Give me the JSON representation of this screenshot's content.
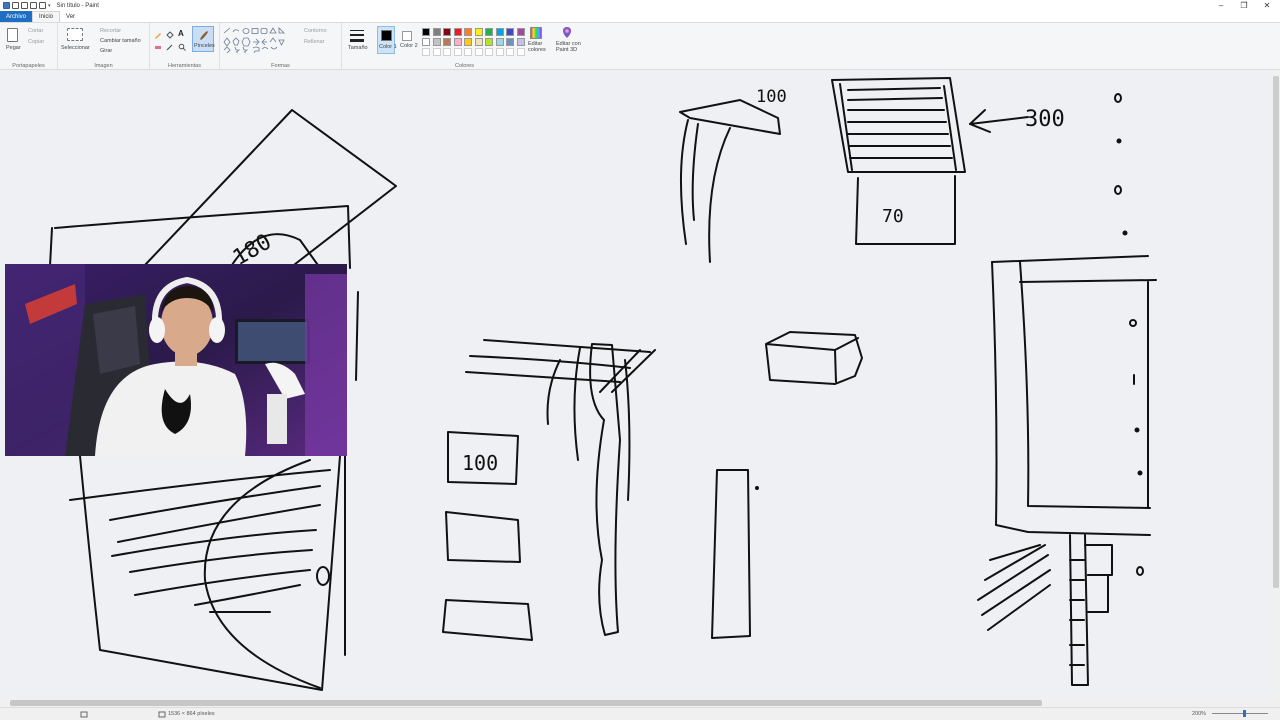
{
  "window": {
    "title": "Sin título - Paint",
    "minimize_glyph": "–",
    "restore_glyph": "❐",
    "close_glyph": "✕"
  },
  "tabs": [
    {
      "label": "Archivo"
    },
    {
      "label": "Inicio"
    },
    {
      "label": "Ver"
    }
  ],
  "ribbon": {
    "clipboard": {
      "label": "Portapapeles",
      "paste": "Pegar",
      "cut": "Cortar",
      "copy": "Copiar"
    },
    "image": {
      "label": "Imagen",
      "select": "Seleccionar",
      "crop": "Recortar",
      "resize": "Cambiar tamaño",
      "rotate": "Girar"
    },
    "tools": {
      "label": "Herramientas",
      "brushes": "Pinceles"
    },
    "shapes": {
      "label": "Formas",
      "outline": "Contorno",
      "fill": "Rellenar"
    },
    "size": "Tamaño",
    "colors": {
      "label": "Colores",
      "color1": "Color 1",
      "color2": "Color 2",
      "edit": "Editar colores",
      "paint3d": "Editar con Paint 3D",
      "palette_row1": [
        "#000000",
        "#7f7f7f",
        "#880015",
        "#ed1c24",
        "#ff7f27",
        "#fff200",
        "#22b14c",
        "#00a2e8",
        "#3f48cc",
        "#a349a4"
      ],
      "palette_row2": [
        "#ffffff",
        "#c3c3c3",
        "#b97a57",
        "#ffaec9",
        "#ffc90e",
        "#efe4b0",
        "#b5e61d",
        "#99d9ea",
        "#7092be",
        "#c8bfe7"
      ]
    }
  },
  "drawing_labels": {
    "a": "180",
    "b": "100",
    "c": "300",
    "d": "70",
    "e": "100"
  },
  "status": {
    "dimensions": "1536 × 864 píxeles",
    "zoom": "200%"
  }
}
